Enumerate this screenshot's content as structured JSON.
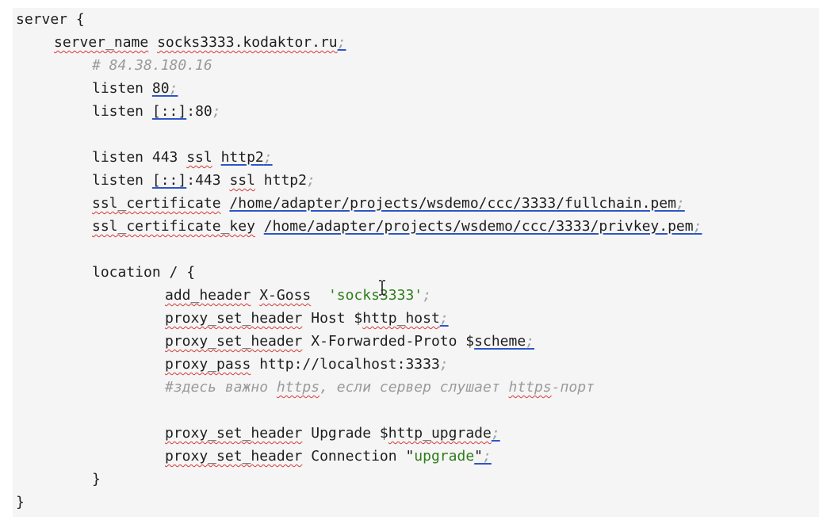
{
  "code": {
    "l1": "server {",
    "l2_kw": "server_name",
    "l2_val": "socks3333.kodaktor.ru",
    "l2_semi": ";",
    "l3_comment": "# 84.38.180.16",
    "l4_kw": "listen",
    "l4_val": "80",
    "l4_semi": ";",
    "l5_kw": "listen",
    "l5_addr": "[::]",
    "l5_rest": ":80",
    "l5_semi": ";",
    "l6_kw": "listen 443",
    "l6_ssl": "ssl",
    "l6_http2": "http2",
    "l6_semi": ";",
    "l7_kw": "listen",
    "l7_addr": "[::]",
    "l7_rest": ":443",
    "l7_ssl": "ssl",
    "l7_http2": "http2",
    "l7_semi": ";",
    "l8_kw": "ssl_certificate",
    "l8_path": "/home/adapter/projects/wsdemo/ccc/3333/fullchain.pem",
    "l8_semi": ";",
    "l9_kw": "ssl_certificate_key",
    "l9_path": "/home/adapter/projects/wsdemo/ccc/3333/privkey.pem",
    "l9_semi": ";",
    "l10": "location / {",
    "l11_kw": "add_header",
    "l11_name": "X-Goss",
    "l11_str": "'socks3333'",
    "l11_semi": ";",
    "l12_kw": "proxy_set_header",
    "l12_name": "Host $",
    "l12_var": "http_host",
    "l12_semi": ";",
    "l13_kw": "proxy_set_header",
    "l13_name": "X-Forwarded-Proto $",
    "l13_var": "scheme",
    "l13_semi": ";",
    "l14_kw": "proxy_pass",
    "l14_url": "http://localhost:3333",
    "l14_semi": ";",
    "l15_a": "#здесь важно ",
    "l15_b": "https",
    "l15_c": ", если сервер слушает ",
    "l15_d": "https",
    "l15_e": "-порт",
    "l16_kw": "proxy_set_header",
    "l16_name": "Upgrade $",
    "l16_var": "http_upgrade",
    "l16_semi": ";",
    "l17_kw": "proxy_set_header",
    "l17_name": "Connection ",
    "l17_q1": "\"",
    "l17_str": "upgrade",
    "l17_q2": "\"",
    "l17_semi": ";",
    "l18": "}",
    "l19": "}"
  },
  "colors": {
    "background": "#f5f5f5",
    "text": "#1e1e1e",
    "string": "#2e7d1a",
    "comment": "#9a9a9a",
    "spell_underline": "#d23a3a",
    "link_underline": "#2f55c9"
  },
  "icons": {
    "cursor": "text-cursor-icon"
  }
}
